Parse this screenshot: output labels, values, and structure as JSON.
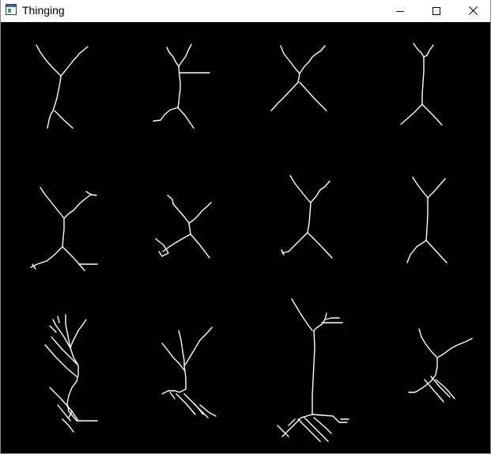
{
  "window": {
    "title": "Thinging"
  },
  "titlebar": {
    "app_icon": "app-window-icon",
    "minimize_icon": "minimize-icon",
    "maximize_icon": "maximize-icon",
    "close_icon": "close-icon"
  },
  "canvas": {
    "background_color": "#000000",
    "stroke_color": "#ffffff"
  },
  "colors": {
    "titlebar_bg": "#ffffff",
    "title_text": "#000000",
    "skeleton": "#ffffff"
  }
}
